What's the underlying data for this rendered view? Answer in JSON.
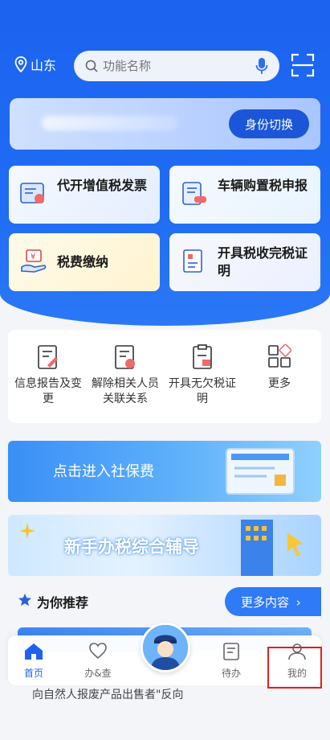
{
  "header": {
    "location": "山东",
    "search_placeholder": "功能名称"
  },
  "identity": {
    "switch_label": "身份切换"
  },
  "cards": [
    {
      "label": "代开增值税发票"
    },
    {
      "label": "车辆购置税申报"
    },
    {
      "label": "税费缴纳"
    },
    {
      "label": "开具税收完税证明"
    }
  ],
  "quick_actions": [
    {
      "label": "信息报告及变更"
    },
    {
      "label": "解除相关人员关联关系"
    },
    {
      "label": "开具无欠税证明"
    },
    {
      "label": "更多"
    }
  ],
  "banners": {
    "social_security": "点击进入社保费",
    "tax_guide": "新手办税综合辅导"
  },
  "recommend": {
    "title": "为你推荐",
    "more_label": "更多内容"
  },
  "feed_text": "向自然人报废产品出售者\"反向",
  "tabs": [
    {
      "label": "首页"
    },
    {
      "label": "办&查"
    },
    {
      "label": "待办"
    },
    {
      "label": "我的"
    }
  ],
  "colors": {
    "brand_blue": "#1c63f0",
    "highlight_red": "#e02020"
  }
}
